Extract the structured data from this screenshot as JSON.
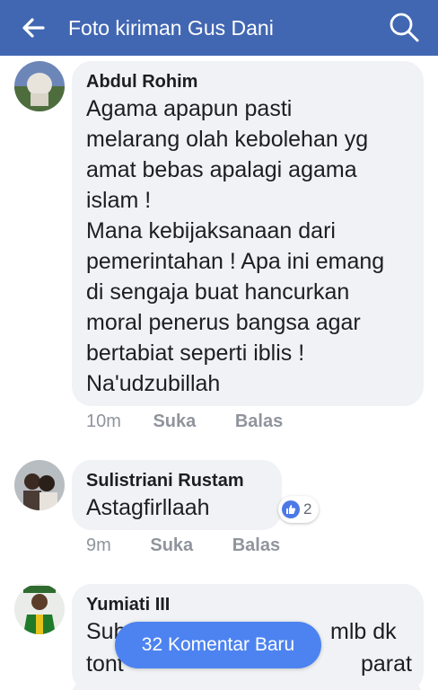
{
  "header": {
    "title": "Foto kiriman Gus Dani",
    "back_icon": "arrow-left-icon",
    "search_icon": "search-icon",
    "color": "#4267b2"
  },
  "comments": [
    {
      "author": "Abdul Rohim",
      "lines": [
        "Agama apapun pasti",
        "melarang olah kebolehan yg",
        "amat bebas apalagi agama",
        "islam !",
        "Mana kebijaksanaan dari",
        "pemerintahan ! Apa ini emang",
        "di sengaja buat hancurkan",
        "moral penerus bangsa agar",
        "bertabiat seperti iblis !",
        "Na'udzubillah"
      ],
      "time": "10m",
      "like_label": "Suka",
      "reply_label": "Balas"
    },
    {
      "author": "Sulistriani Rustam",
      "lines": [
        "Astagfirllaah"
      ],
      "time": "9m",
      "like_label": "Suka",
      "reply_label": "Balas",
      "reaction_count": "2"
    },
    {
      "author": "Yumiati III",
      "lines": [
        "Sub",
        "mlb dk",
        "tont",
        "parat"
      ]
    }
  ],
  "new_comments_label": "32 Komentar Baru"
}
